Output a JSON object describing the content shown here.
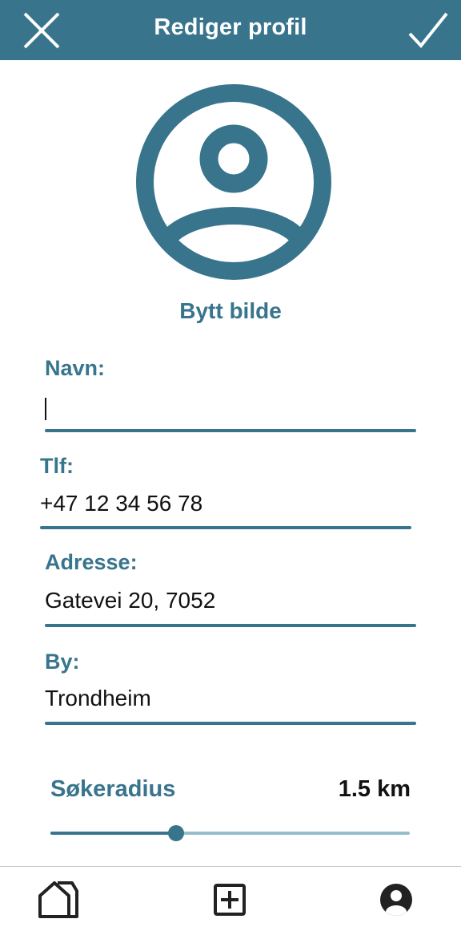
{
  "header": {
    "title": "Rediger profil",
    "close_icon": "close-icon",
    "confirm_icon": "check-icon"
  },
  "profile": {
    "avatar_icon": "user-circle-icon",
    "change_photo_label": "Bytt bilde"
  },
  "form": {
    "name": {
      "label": "Navn:",
      "value": ""
    },
    "phone": {
      "label": "Tlf:",
      "value": "+47 12 34 56 78"
    },
    "address": {
      "label": "Adresse:",
      "value": "Gatevei 20, 7052"
    },
    "city": {
      "label": "By:",
      "value": "Trondheim"
    }
  },
  "search_radius": {
    "label": "Søkeradius",
    "value_text": "1.5 km",
    "slider_fraction": 0.35
  },
  "bottom_nav": {
    "items": [
      {
        "icon": "home-icon"
      },
      {
        "icon": "add-box-icon"
      },
      {
        "icon": "account-circle-icon"
      }
    ]
  },
  "colors": {
    "primary": "#38758d",
    "slider_track": "#97bccb",
    "text": "#111111"
  }
}
